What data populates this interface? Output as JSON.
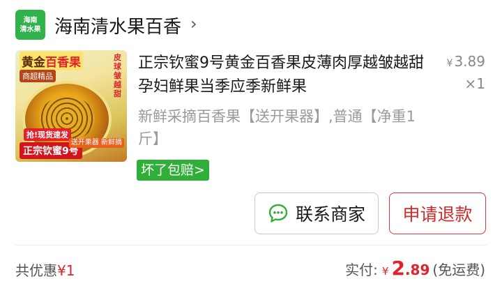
{
  "store": {
    "logo_line1": "海南",
    "logo_line2": "清水果",
    "name": "海南清水果百香",
    "chevron": "›"
  },
  "product": {
    "thumbnail": {
      "title_a": "黄金",
      "title_b": "百香果",
      "side_text": "皮球皱越甜",
      "quality_tag": "商超精品",
      "ship_tag": "抢!现货速发",
      "banner": "正宗钦蜜9号",
      "fresh_tag": "送开果器 新鲜摘"
    },
    "title": "正宗钦蜜9号黄金百香果皮薄肉厚越皱越甜孕妇鲜果当季应季新鲜果",
    "price_symbol": "¥",
    "price": "3.89",
    "quantity": "×1",
    "spec": "新鲜采摘百香果【送开果器】,普通【净重1斤】",
    "guarantee": "坏了包赔>"
  },
  "actions": {
    "contact_label": "联系商家",
    "refund_label": "申请退款"
  },
  "summary": {
    "discount_label": "共优惠",
    "discount_amount": "¥1",
    "paid_label": "实付:",
    "paid_symbol": "¥",
    "paid_int": "2",
    "paid_dec": ".89",
    "shipping_note": "(免运费)"
  },
  "colors": {
    "accent_red": "#e0222b",
    "guarantee_green": "#2faf37",
    "chat_green": "#2faf37"
  },
  "icons": {
    "store_chevron": "chevron-right-icon",
    "contact": "chat-bubble-icon"
  }
}
